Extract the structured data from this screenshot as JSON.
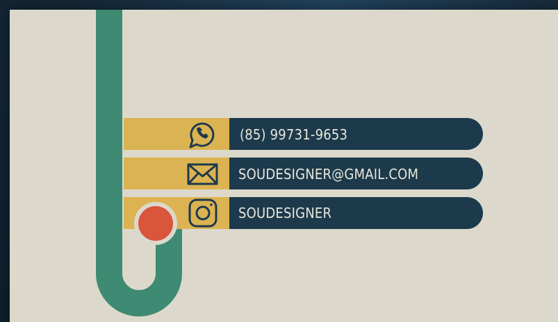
{
  "colors": {
    "card": "#dcd9cc",
    "green": "#3e8a72",
    "mustard": "#dcb352",
    "navy": "#1d3a4c",
    "red": "#d9553b",
    "icon_stroke": "#1d3a4c",
    "text": "#e8e6da"
  },
  "contacts": [
    {
      "icon": "whatsapp-icon",
      "text": "(85) 99731-9653"
    },
    {
      "icon": "mail-icon",
      "text": "SOUDESIGNER@GMAIL.COM"
    },
    {
      "icon": "instagram-icon",
      "text": "SOUDESIGNER"
    }
  ]
}
